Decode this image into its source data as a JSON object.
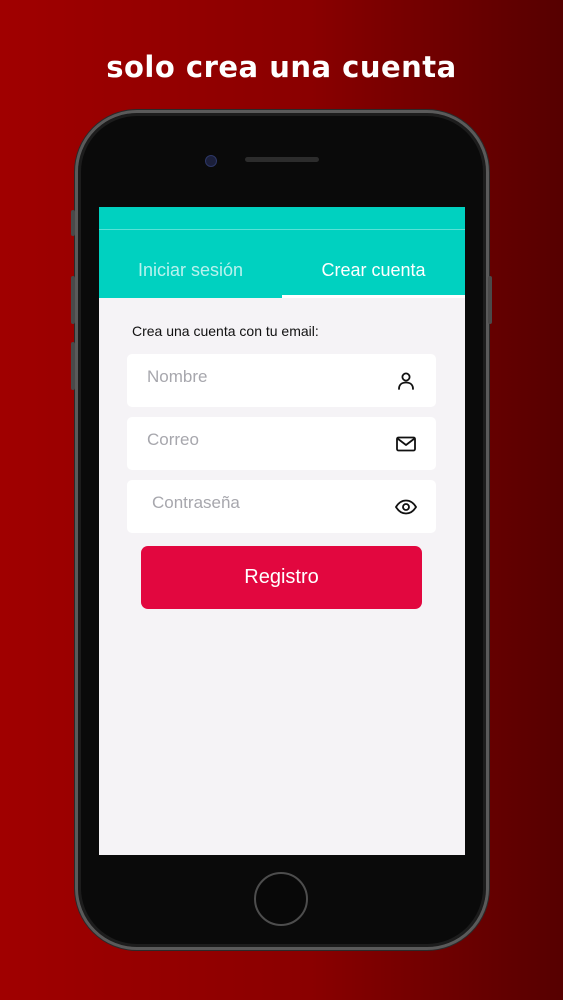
{
  "promo": {
    "headline": "solo crea una cuenta"
  },
  "colors": {
    "accent": "#00d1c0",
    "primary_button": "#e2073f",
    "background_red": "#a00000"
  },
  "tabs": [
    {
      "label": "Iniciar sesión",
      "active": false
    },
    {
      "label": "Crear cuenta",
      "active": true
    }
  ],
  "form": {
    "instruction": "Crea una cuenta con tu email:",
    "name_field": {
      "placeholder": "Nombre",
      "value": "",
      "icon": "user-icon"
    },
    "email_field": {
      "placeholder": "Correo",
      "value": "",
      "icon": "mail-icon"
    },
    "password_field": {
      "placeholder": "Contraseña",
      "value": "",
      "icon": "eye-icon"
    },
    "submit_label": "Registro"
  }
}
